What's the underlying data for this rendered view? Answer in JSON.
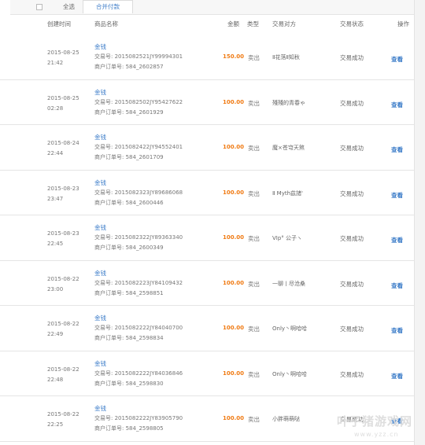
{
  "toolbar": {
    "select_all": "全选",
    "merge_pay": "合并付款"
  },
  "columns": {
    "created": "创建时间",
    "goods": "商品名称",
    "amount": "金额",
    "type": "类型",
    "counterparty": "交易对方",
    "status": "交易状态",
    "action": "操作"
  },
  "rows": [
    {
      "date": "2015-08-25",
      "time": "21:42",
      "name": "金钱",
      "trade_label": "交易号:",
      "trade_no": "2015082521JY99994301",
      "order_label": "商户订单号:",
      "order_no": "584_2602857",
      "amount": "150.00",
      "type": "卖出",
      "party": "Ⅱ花落Ⅱ知秋",
      "status": "交易成功",
      "action": "查看"
    },
    {
      "date": "2015-08-25",
      "time": "02:28",
      "name": "金钱",
      "trade_label": "交易号:",
      "trade_no": "2015082502JY95427622",
      "order_label": "商户订单号:",
      "order_no": "584_2601929",
      "amount": "100.00",
      "type": "卖出",
      "party": "殘殘的青春ゃ",
      "status": "交易成功",
      "action": "查看"
    },
    {
      "date": "2015-08-24",
      "time": "22:44",
      "name": "金钱",
      "trade_label": "交易号:",
      "trade_no": "2015082422JY94552401",
      "order_label": "商户订单号:",
      "order_no": "584_2601709",
      "amount": "100.00",
      "type": "卖出",
      "party": "魔×苍穹天煞",
      "status": "交易成功",
      "action": "查看"
    },
    {
      "date": "2015-08-23",
      "time": "23:47",
      "name": "金钱",
      "trade_label": "交易号:",
      "trade_no": "2015082323JY89686068",
      "order_label": "商户订单号:",
      "order_no": "584_2600446",
      "amount": "100.00",
      "type": "卖出",
      "party": "Ⅱ Myth茲諸'",
      "status": "交易成功",
      "action": "查看"
    },
    {
      "date": "2015-08-23",
      "time": "22:45",
      "name": "金钱",
      "trade_label": "交易号:",
      "trade_no": "2015082322JY89363340",
      "order_label": "商户订单号:",
      "order_no": "584_2600349",
      "amount": "100.00",
      "type": "卖出",
      "party": "VIp° 公子ヽ",
      "status": "交易成功",
      "action": "查看"
    },
    {
      "date": "2015-08-22",
      "time": "23:00",
      "name": "金钱",
      "trade_label": "交易号:",
      "trade_no": "2015082223JY84109432",
      "order_label": "商户订单号:",
      "order_no": "584_2598851",
      "amount": "100.00",
      "type": "卖出",
      "party": "一聊丨尽沧桑",
      "status": "交易成功",
      "action": "查看"
    },
    {
      "date": "2015-08-22",
      "time": "22:49",
      "name": "金钱",
      "trade_label": "交易号:",
      "trade_no": "2015082222JY84040700",
      "order_label": "商户订单号:",
      "order_no": "584_2598834",
      "amount": "100.00",
      "type": "卖出",
      "party": "Only丶啊哈哈",
      "status": "交易成功",
      "action": "查看"
    },
    {
      "date": "2015-08-22",
      "time": "22:48",
      "name": "金钱",
      "trade_label": "交易号:",
      "trade_no": "2015082222JY84036846",
      "order_label": "商户订单号:",
      "order_no": "584_2598830",
      "amount": "100.00",
      "type": "卖出",
      "party": "Only丶啊哈哈",
      "status": "交易成功",
      "action": "查看"
    },
    {
      "date": "2015-08-22",
      "time": "22:25",
      "name": "金钱",
      "trade_label": "交易号:",
      "trade_no": "2015082222JY83905790",
      "order_label": "商户订单号:",
      "order_no": "584_2598805",
      "amount": "100.00",
      "type": "卖出",
      "party": "小胖萌萌哒",
      "status": "交易成功",
      "action": "查看"
    }
  ],
  "watermark": {
    "brand": "叶子猪游戏网",
    "url": "www.yzz.cn"
  }
}
